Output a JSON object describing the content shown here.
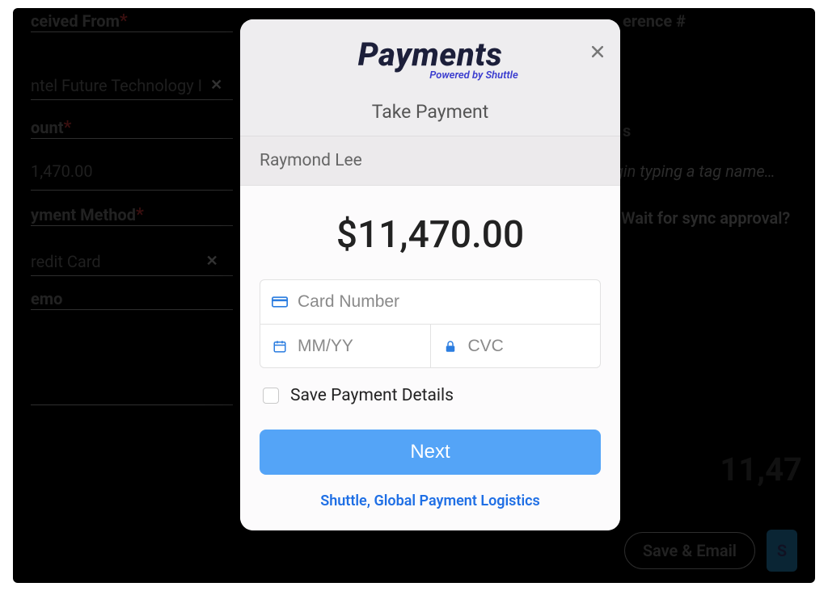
{
  "background_form": {
    "received_from": {
      "label": "ceived From",
      "req": "*",
      "value": "ntel Future Technology I"
    },
    "amount": {
      "label": "ount",
      "req": "*",
      "value": "1,470.00"
    },
    "payment_method": {
      "label": "yment Method",
      "req": "*",
      "value": "redit Card"
    },
    "memo": {
      "label": "emo"
    },
    "reference": {
      "label": "erence #"
    },
    "tags": {
      "label": "s",
      "placeholder": "gin typing a tag name…"
    },
    "sync_label": "Wait for sync approval?",
    "summary_total": "11,47",
    "save_email_label": "Save & Email",
    "secondary_button_label": "S"
  },
  "modal": {
    "brand_wordmark": "Payments",
    "brand_tagline": "Powered by Shuttle",
    "title": "Take Payment",
    "customer_name": "Raymond Lee",
    "amount_display": "$11,470.00",
    "card_number_placeholder": "Card Number",
    "expiry_placeholder": "MM/YY",
    "cvc_placeholder": "CVC",
    "save_details_label": "Save Payment Details",
    "next_label": "Next",
    "footer_link": "Shuttle, Global Payment Logistics"
  },
  "colors": {
    "accent_blue": "#54a4f7",
    "link_blue": "#1f6fe5",
    "brand_tagline": "#3a3ccf"
  }
}
